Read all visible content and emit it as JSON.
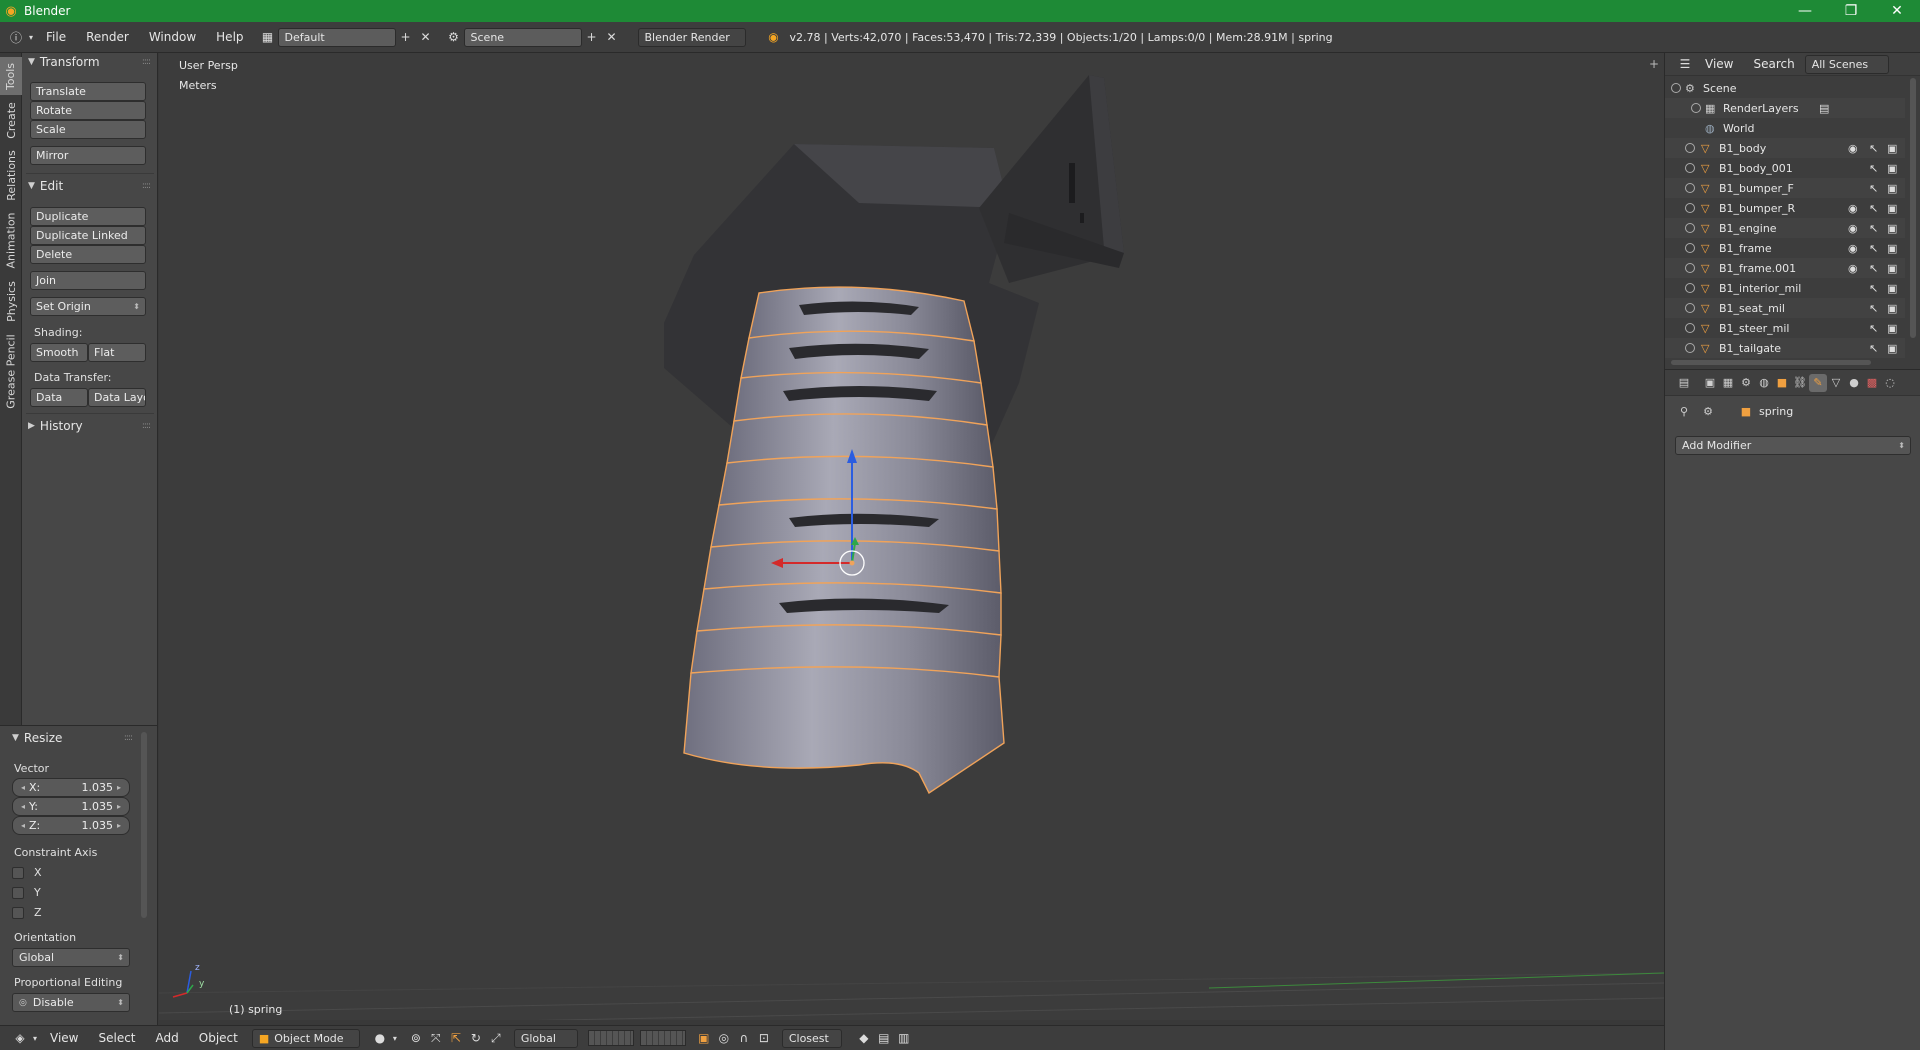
{
  "window": {
    "title": "Blender",
    "minimize": "—",
    "maximize": "❐",
    "close": "✕"
  },
  "info_header": {
    "menus": [
      "File",
      "Render",
      "Window",
      "Help"
    ],
    "layout": "Default",
    "scene": "Scene",
    "engine": "Blender Render",
    "stats": "v2.78 | Verts:42,070 | Faces:53,470 | Tris:72,339 | Objects:1/20 | Lamps:0/0 | Mem:28.91M | spring"
  },
  "left_tabs": [
    "Tools",
    "Create",
    "Relations",
    "Animation",
    "Physics",
    "Grease Pencil"
  ],
  "tool_shelf": {
    "transform": {
      "header": "Transform",
      "buttons": [
        "Translate",
        "Rotate",
        "Scale",
        "Mirror"
      ]
    },
    "edit": {
      "header": "Edit",
      "buttons": [
        "Duplicate",
        "Duplicate Linked",
        "Delete",
        "Join",
        "Set Origin"
      ],
      "shading_label": "Shading:",
      "smooth": "Smooth",
      "flat": "Flat",
      "data_transfer_label": "Data Transfer:",
      "data": "Data",
      "data_layout": "Data Layo"
    },
    "history": {
      "header": "History"
    }
  },
  "resize_panel": {
    "header": "Resize",
    "vector_label": "Vector",
    "x_label": "X:",
    "x_value": "1.035",
    "y_label": "Y:",
    "y_value": "1.035",
    "z_label": "Z:",
    "z_value": "1.035",
    "constraint_label": "Constraint Axis",
    "axes": [
      "X",
      "Y",
      "Z"
    ],
    "orientation_label": "Orientation",
    "orientation_value": "Global",
    "proportional_label": "Proportional Editing",
    "proportional_value": "Disable"
  },
  "viewport": {
    "view_name": "User Persp",
    "units": "Meters",
    "object_label": "(1) spring",
    "axis_z": "z",
    "axis_y": "y"
  },
  "bottom_header": {
    "menus": [
      "View",
      "Select",
      "Add",
      "Object"
    ],
    "mode": "Object Mode",
    "orientation": "Global",
    "snap": "Closest"
  },
  "outliner": {
    "view": "View",
    "search": "Search",
    "filter": "All Scenes",
    "items": [
      {
        "name": "Scene"
      },
      {
        "name": "RenderLayers"
      },
      {
        "name": "World"
      },
      {
        "name": "B1_body"
      },
      {
        "name": "B1_body_001"
      },
      {
        "name": "B1_bumper_F"
      },
      {
        "name": "B1_bumper_R"
      },
      {
        "name": "B1_engine"
      },
      {
        "name": "B1_frame"
      },
      {
        "name": "B1_frame.001"
      },
      {
        "name": "B1_interior_mil"
      },
      {
        "name": "B1_seat_mil"
      },
      {
        "name": "B1_steer_mil"
      },
      {
        "name": "B1_tailgate"
      }
    ]
  },
  "properties": {
    "object_name": "spring",
    "add_modifier": "Add Modifier"
  },
  "colors": {
    "titlebar": "#1e8a36",
    "selection_outline": "#f0a35a",
    "accent": "#f5a623"
  }
}
